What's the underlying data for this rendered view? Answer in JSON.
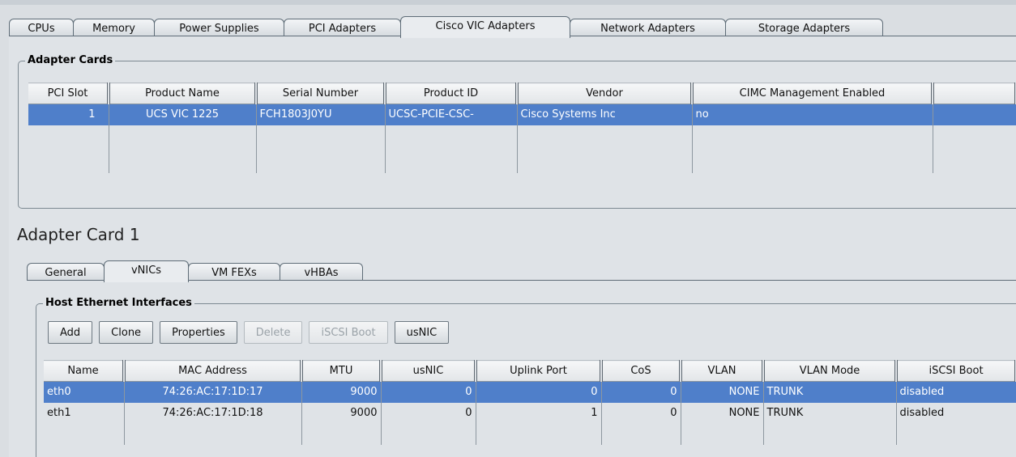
{
  "top_tabs": [
    {
      "label": "CPUs",
      "active": false
    },
    {
      "label": "Memory",
      "active": false
    },
    {
      "label": "Power Supplies",
      "active": false
    },
    {
      "label": "PCI Adapters",
      "active": false
    },
    {
      "label": "Cisco VIC Adapters",
      "active": true
    },
    {
      "label": "Network Adapters",
      "active": false
    },
    {
      "label": "Storage Adapters",
      "active": false
    }
  ],
  "adapter_cards": {
    "legend": "Adapter Cards",
    "columns": [
      "PCI Slot",
      "Product Name",
      "Serial Number",
      "Product ID",
      "Vendor",
      "CIMC Management Enabled",
      ""
    ],
    "rows": [
      {
        "pci_slot": "1",
        "product_name": "UCS VIC 1225",
        "serial_number": "FCH1803J0YU",
        "product_id": "UCSC-PCIE-CSC-",
        "vendor": "Cisco Systems Inc",
        "cimc": "no",
        "extra": ""
      }
    ]
  },
  "detail": {
    "heading": "Adapter Card 1",
    "tabs": [
      {
        "label": "General",
        "active": false
      },
      {
        "label": "vNICs",
        "active": true
      },
      {
        "label": "VM FEXs",
        "active": false
      },
      {
        "label": "vHBAs",
        "active": false
      }
    ],
    "legend": "Host Ethernet Interfaces",
    "buttons": [
      {
        "label": "Add",
        "enabled": true
      },
      {
        "label": "Clone",
        "enabled": true
      },
      {
        "label": "Properties",
        "enabled": true
      },
      {
        "label": "Delete",
        "enabled": false
      },
      {
        "label": "iSCSI Boot",
        "enabled": false
      },
      {
        "label": "usNIC",
        "enabled": true
      }
    ],
    "columns": [
      "Name",
      "MAC Address",
      "MTU",
      "usNIC",
      "Uplink Port",
      "CoS",
      "VLAN",
      "VLAN Mode",
      "iSCSI Boot"
    ],
    "rows": [
      {
        "name": "eth0",
        "mac": "74:26:AC:17:1D:17",
        "mtu": "9000",
        "usnic": "0",
        "uplink": "0",
        "cos": "0",
        "vlan": "NONE",
        "vlan_mode": "TRUNK",
        "iscsi": "disabled"
      },
      {
        "name": "eth1",
        "mac": "74:26:AC:17:1D:18",
        "mtu": "9000",
        "usnic": "0",
        "uplink": "1",
        "cos": "0",
        "vlan": "NONE",
        "vlan_mode": "TRUNK",
        "iscsi": "disabled"
      }
    ]
  }
}
